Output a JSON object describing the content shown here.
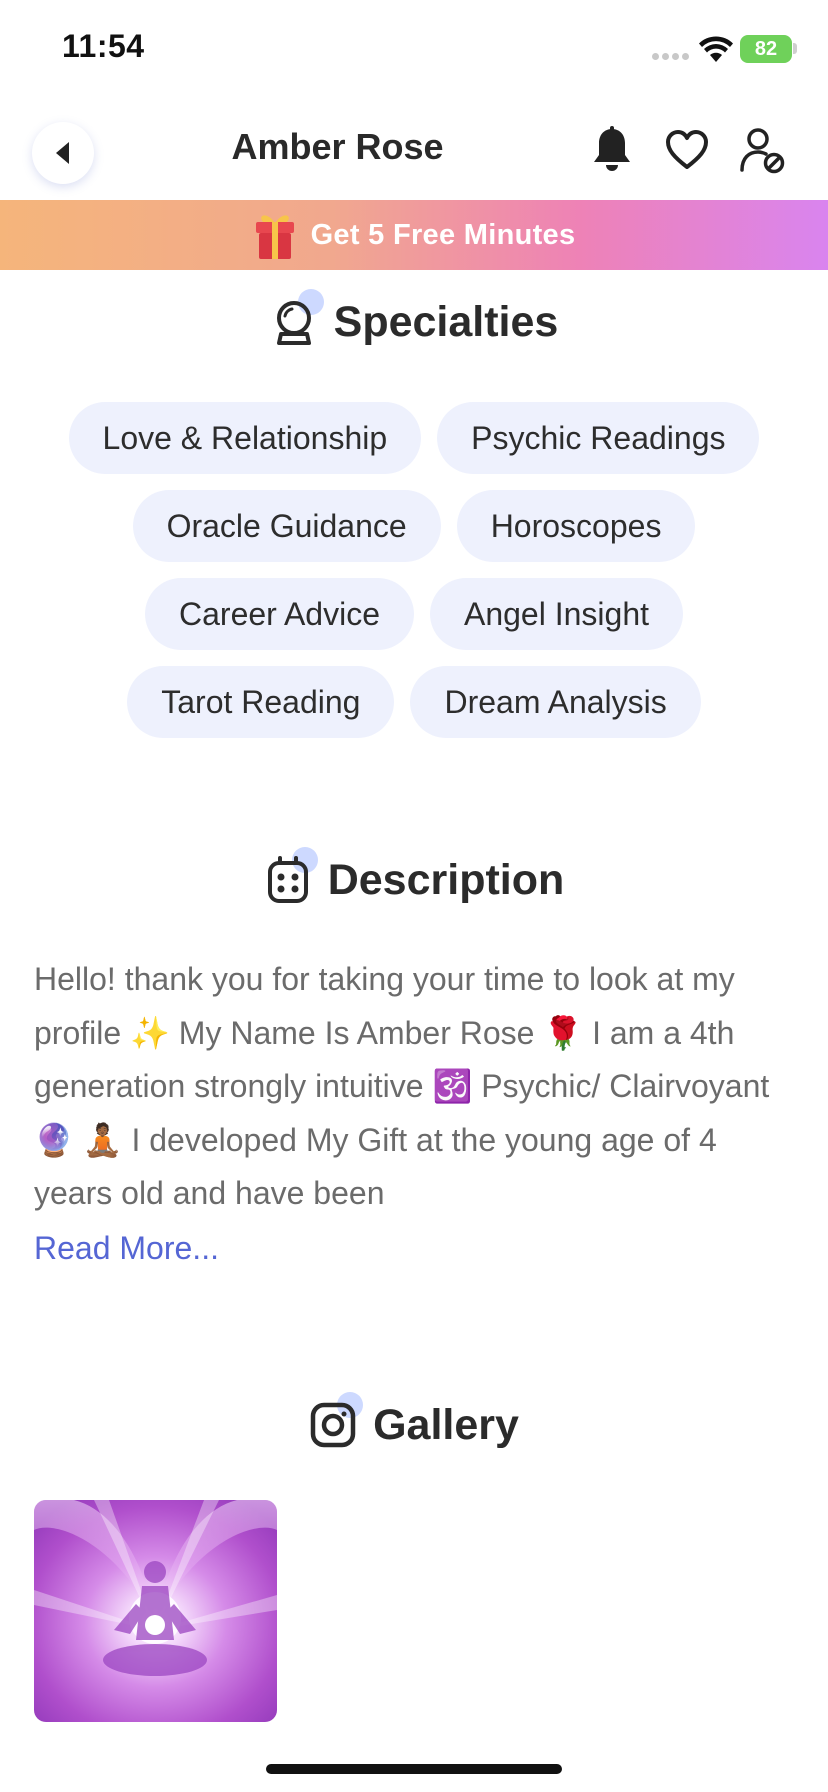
{
  "status_bar": {
    "time": "11:54",
    "battery": "82"
  },
  "nav": {
    "title": "Amber Rose"
  },
  "promo": {
    "text": "Get 5 Free Minutes"
  },
  "specialties": {
    "title": "Specialties",
    "rows": [
      [
        "Love & Relationship",
        "Psychic Readings"
      ],
      [
        "Oracle Guidance",
        "Horoscopes"
      ],
      [
        "Career Advice",
        "Angel Insight"
      ],
      [
        "Tarot Reading",
        "Dream Analysis"
      ]
    ]
  },
  "description": {
    "title": "Description",
    "text": "Hello! thank you for taking your time to look at my profile ✨  My Name Is Amber Rose 🌹  I am a 4th generation strongly intuitive 🕉️  Psychic/ Clairvoyant 🔮 🧘🏾  I developed My Gift at the young age of 4 years old and have been",
    "read_more": "Read More..."
  },
  "gallery": {
    "title": "Gallery",
    "items": [
      {
        "icon": "meditation-image"
      }
    ]
  },
  "colors": {
    "chip_bg": "#eef1fd",
    "link": "#5566d4",
    "battery": "#6fd15a"
  }
}
